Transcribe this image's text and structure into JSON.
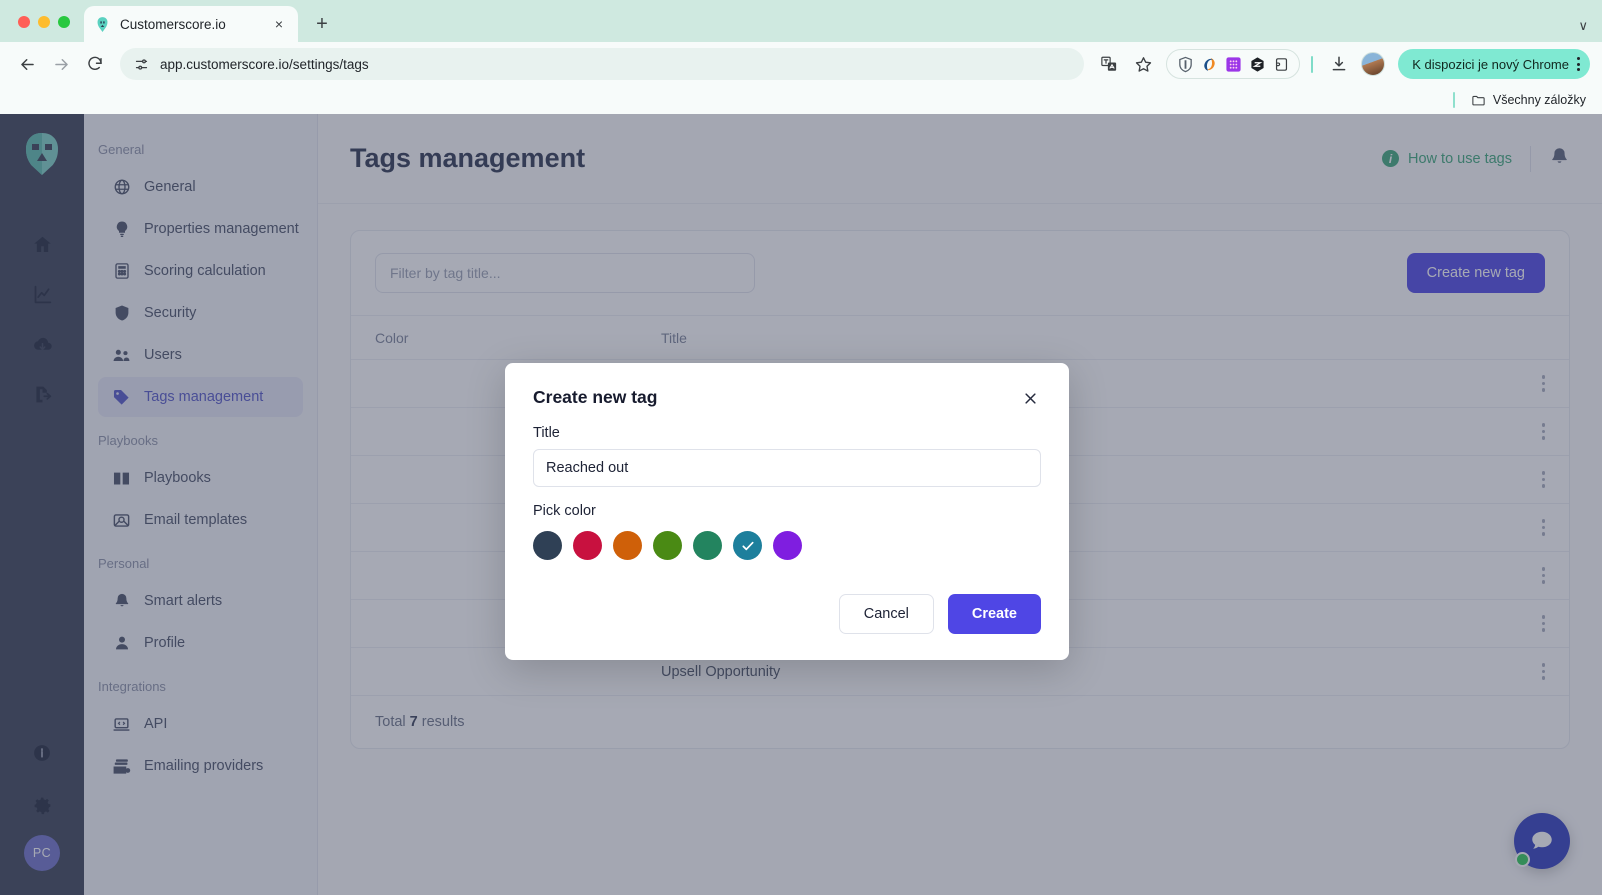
{
  "browser": {
    "tab": {
      "title": "Customerscore.io",
      "favicon": "spartan-helmet-icon",
      "close": "×"
    },
    "new_tab": "+",
    "tab_list_chevron": "∨",
    "nav": {
      "back": "←",
      "forward": "→",
      "reload": "↻"
    },
    "omnibox": {
      "url": "app.customerscore.io/settings/tags",
      "site_info_icon": "site-settings-icon"
    },
    "translate_icon": "translate-icon",
    "bookmark_star_icon": "star-icon",
    "extensions": [
      "shield-extension-icon",
      "swirl-extension-icon",
      "grid-extension-icon",
      "hexagon-extension-icon",
      "puzzle-extension-icon"
    ],
    "download_icon": "download-icon",
    "profile_avatar": "profile-avatar",
    "update_pill": {
      "label": "K dispozici je nový Chrome",
      "menu_icon": "three-dot-menu-icon"
    },
    "bookmarks_bar": {
      "folder_icon": "folder-icon",
      "label": "Všechny záložky"
    }
  },
  "rail": {
    "logo": "spartan-helmet-logo",
    "icons": [
      "home-icon",
      "analytics-icon",
      "cloud-download-icon",
      "export-icon"
    ],
    "bottom_icons": [
      "info-icon",
      "gear-icon"
    ],
    "avatar_initials": "PC"
  },
  "sidebar": {
    "groups": [
      {
        "label": "General",
        "items": [
          {
            "label": "General",
            "icon": "globe-icon",
            "active": false
          },
          {
            "label": "Properties management",
            "icon": "lightbulb-icon",
            "active": false
          },
          {
            "label": "Scoring calculation",
            "icon": "calculator-icon",
            "active": false
          },
          {
            "label": "Security",
            "icon": "shield-icon",
            "active": false
          },
          {
            "label": "Users",
            "icon": "users-icon",
            "active": false
          },
          {
            "label": "Tags management",
            "icon": "tag-icon",
            "active": true
          }
        ]
      },
      {
        "label": "Playbooks",
        "items": [
          {
            "label": "Playbooks",
            "icon": "book-icon",
            "active": false
          },
          {
            "label": "Email templates",
            "icon": "envelope-icon",
            "active": false
          }
        ]
      },
      {
        "label": "Personal",
        "items": [
          {
            "label": "Smart alerts",
            "icon": "bell-icon",
            "active": false
          },
          {
            "label": "Profile",
            "icon": "person-icon",
            "active": false
          }
        ]
      },
      {
        "label": "Integrations",
        "items": [
          {
            "label": "API",
            "icon": "laptop-code-icon",
            "active": false
          },
          {
            "label": "Emailing providers",
            "icon": "mail-stack-icon",
            "active": false
          }
        ]
      }
    ]
  },
  "page": {
    "title": "Tags management",
    "how_to_use": {
      "label": "How to use tags",
      "icon": "info-circle-icon",
      "color": "#3da87a"
    },
    "notification_icon": "bell-icon",
    "filter_placeholder": "Filter by tag title...",
    "create_button": "Create new tag",
    "table": {
      "columns": [
        "Color",
        "Title"
      ],
      "rows": [
        {
          "color": "#a06379",
          "title": ""
        },
        {
          "color": "#578494",
          "title": ""
        },
        {
          "color": "#7b70b8",
          "title": ""
        },
        {
          "color": "#616a7f",
          "title": ""
        },
        {
          "color": "#a47a74",
          "title": ""
        },
        {
          "color": "#6b8a73",
          "title": ""
        },
        {
          "color": "#548382",
          "title": "Upsell Opportunity"
        }
      ],
      "row_menu_icon": "three-dot-menu-icon",
      "footer_prefix": "Total",
      "footer_count": "7",
      "footer_suffix": "results"
    },
    "chat_widget": {
      "icon": "chat-bubble-icon",
      "status": "online",
      "color": "#2f3bbf"
    }
  },
  "modal": {
    "title": "Create new tag",
    "close_icon": "close-icon",
    "title_label": "Title",
    "title_value": "Reached out",
    "title_placeholder": "",
    "pick_color_label": "Pick color",
    "colors": [
      {
        "hex": "#2f4055",
        "selected": false
      },
      {
        "hex": "#c8113f",
        "selected": false
      },
      {
        "hex": "#cf6009",
        "selected": false
      },
      {
        "hex": "#4a8a14",
        "selected": false
      },
      {
        "hex": "#23845f",
        "selected": false
      },
      {
        "hex": "#1d7f9c",
        "selected": true
      },
      {
        "hex": "#7f1ee0",
        "selected": false
      }
    ],
    "selected_check_icon": "check-icon",
    "cancel_label": "Cancel",
    "create_label": "Create"
  }
}
